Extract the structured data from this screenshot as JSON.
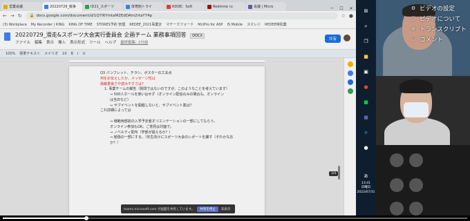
{
  "browser": {
    "tabs": [
      {
        "label": "営業会議",
        "color": "#f4b400"
      },
      {
        "label": "20220729_競争",
        "color": "#4285f4",
        "active": true
      },
      {
        "label": "ID21_スポーツ",
        "color": "#34a853"
      },
      {
        "label": "体育館トライ",
        "color": "#4285f4"
      },
      {
        "label": "RDDE：Soft",
        "color": "#ea4335"
      },
      {
        "label": "Redmine ru",
        "color": "#a50e0e"
      },
      {
        "label": "会議 | Micro",
        "color": "#6264a7"
      }
    ],
    "url": "docs.google.com/document/d/1Q7l6YmtaM2EdDAm2rtaY74p",
    "bookmarks": [
      "(3) Workplace",
      "My Recorder | KING",
      "KING OF TIME",
      "STORES予約 管理",
      "REDEE_2021事業計",
      "マテークフォード",
      "McIPro for ASP",
      "IS Mobile",
      "スマレジ",
      "REDEE特別業"
    ],
    "window_controls": [
      "─",
      "☐",
      "✕"
    ]
  },
  "docs": {
    "title": "20220729_滑走&スポーツ大会実行委員会 企画チーム 業務事項回答",
    "badge": "DOCX",
    "menus": [
      "ファイル",
      "編集",
      "表示",
      "挿入",
      "表示形式",
      "ツール",
      "ヘルプ"
    ],
    "last_edit": "最終編集: 2分前",
    "share_label": "共有",
    "toolbar": [
      "100%",
      "標準テキスト",
      "メイリオ",
      "10",
      "B",
      "I",
      "U"
    ],
    "content": [
      {
        "text": "Q3 パンフレット、チラシ、ポスターの工夫点",
        "style": "normal"
      },
      {
        "text": "何をお伝えしたか、メッセージ性は",
        "style": "red"
      },
      {
        "text": "掲載量良さや読みやすさは？",
        "style": "red"
      },
      {
        "text": "1.  事業チームの報告（質問ではないのですが、このようなことを考えています）",
        "style": "ind"
      },
      {
        "text": "⇒ 500人ホールを使いはせず（オンライン配信のみの場合も、オンライン",
        "style": "ind2"
      },
      {
        "text": "は当日など）",
        "style": "ind2"
      },
      {
        "text": "⇒ サブイベントを開催しないと、サブイベント案は？",
        "style": "ind2"
      },
      {
        "text": "これ詳細によっては",
        "style": "normal"
      },
      {
        "text": "",
        "style": "normal"
      },
      {
        "text": "⇒ 稽範両部前の入学予定者オリエンテーションの一部にしてもらう。",
        "style": "ind2"
      },
      {
        "text": "オンライン参加もOK。ご意見は対面で。",
        "style": "ind2"
      },
      {
        "text": "⇒ ノベルティ配布（学部が揃えるか？）",
        "style": "ind2"
      },
      {
        "text": "⇒ 勉強の一部にする。（年生向けにスポーツ大会のレポートを課す（それかなお",
        "style": "ind2"
      },
      {
        "text": "か？）",
        "style": "ind2"
      }
    ],
    "page_indicator": "3/4"
  },
  "share_bar": {
    "text": "teams.microsoft.com が画面を共有しています。",
    "stop_label": "共有を停止",
    "hide_label": "非表示"
  },
  "taskbar": {
    "time": "13:41",
    "day": "日曜日",
    "date": "2022/07/31",
    "lang": "あ"
  },
  "context_menu": {
    "items": [
      {
        "label": "ビデオの設定",
        "icon": "gear-icon",
        "glyph": "⚙"
      },
      {
        "label": "ビデオについて",
        "icon": "info-icon",
        "glyph": "ⓘ"
      },
      {
        "label": "トランスクリプト",
        "icon": "transcript-icon",
        "glyph": "≡"
      },
      {
        "label": "コメント",
        "icon": "comment-icon",
        "glyph": "▭"
      }
    ]
  },
  "video": {
    "progress": 0.18
  }
}
